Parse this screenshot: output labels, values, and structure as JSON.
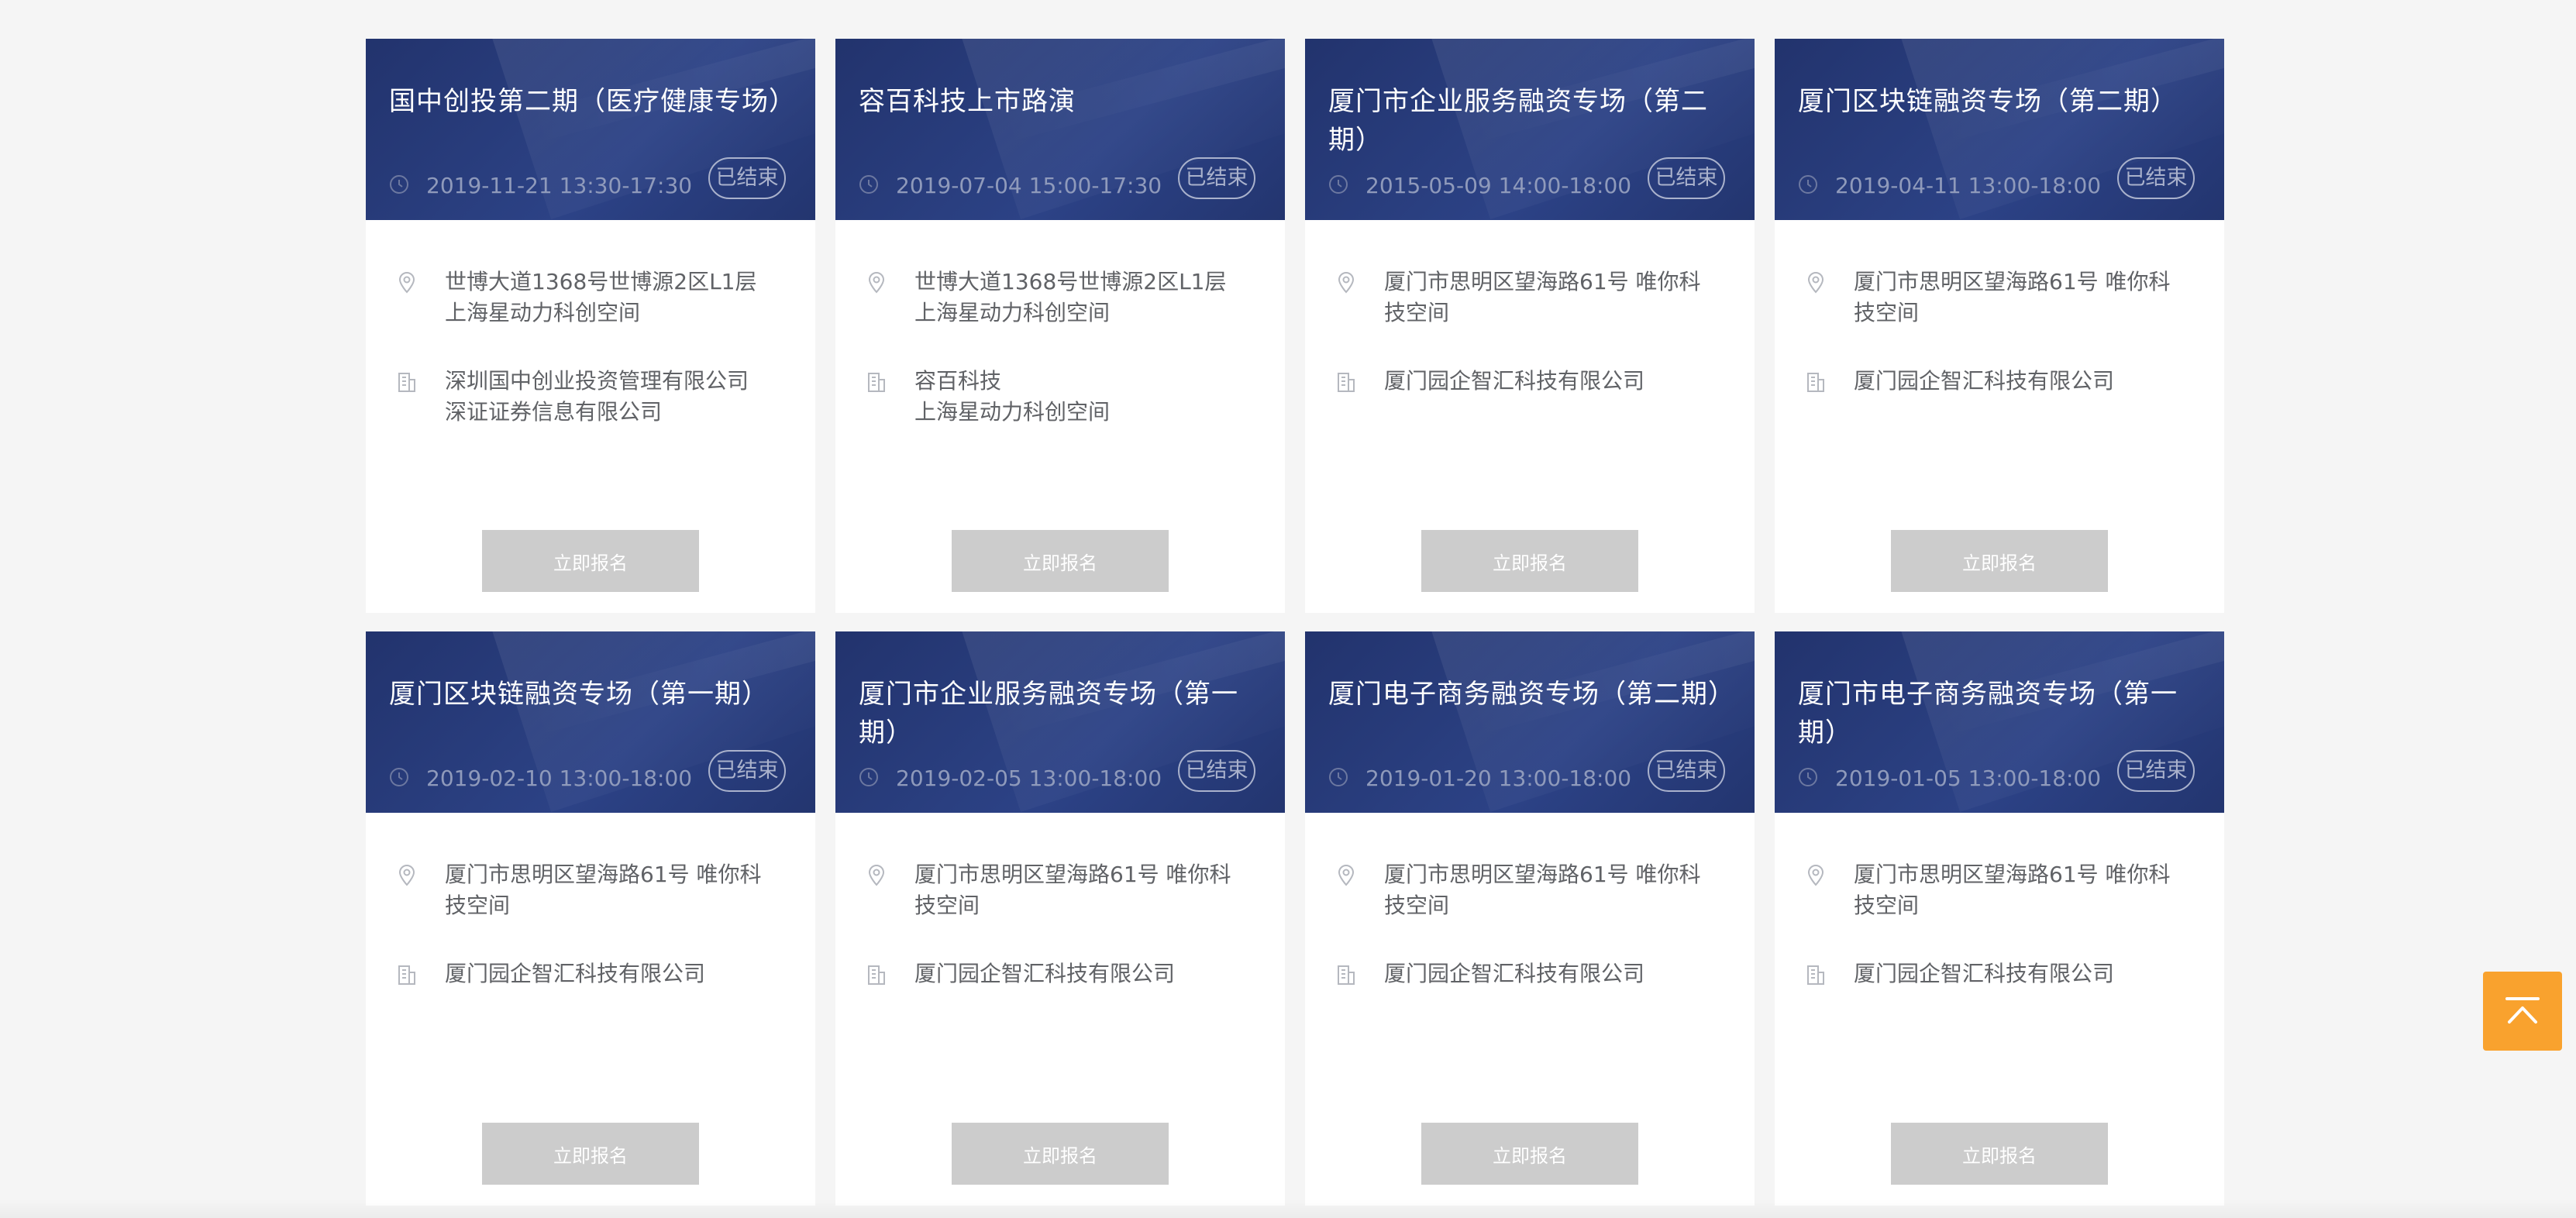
{
  "events": [
    {
      "title": "国中创投第二期（医疗健康专场）",
      "time": "2019-11-21 13:30-17:30",
      "status": "已结束",
      "address": "世博大道1368号世博源2区L1层上海星动力科创空间",
      "organizer": "深圳国中创业投资管理有限公司\n深证证券信息有限公司",
      "button": "立即报名"
    },
    {
      "title": "容百科技上市路演",
      "time": "2019-07-04 15:00-17:30",
      "status": "已结束",
      "address": "世博大道1368号世博源2区L1层上海星动力科创空间",
      "organizer": "容百科技\n上海星动力科创空间",
      "button": "立即报名"
    },
    {
      "title": "厦门市企业服务融资专场（第二期）",
      "time": "2015-05-09 14:00-18:00",
      "status": "已结束",
      "address": "厦门市思明区望海路61号 唯你科技空间",
      "organizer": "厦门园企智汇科技有限公司",
      "button": "立即报名"
    },
    {
      "title": "厦门区块链融资专场（第二期）",
      "time": "2019-04-11 13:00-18:00",
      "status": "已结束",
      "address": "厦门市思明区望海路61号 唯你科技空间",
      "organizer": "厦门园企智汇科技有限公司",
      "button": "立即报名"
    },
    {
      "title": "厦门区块链融资专场（第一期）",
      "time": "2019-02-10 13:00-18:00",
      "status": "已结束",
      "address": "厦门市思明区望海路61号 唯你科技空间",
      "organizer": "厦门园企智汇科技有限公司",
      "button": "立即报名"
    },
    {
      "title": "厦门市企业服务融资专场（第一期）",
      "time": "2019-02-05 13:00-18:00",
      "status": "已结束",
      "address": "厦门市思明区望海路61号 唯你科技空间",
      "organizer": "厦门园企智汇科技有限公司",
      "button": "立即报名"
    },
    {
      "title": "厦门电子商务融资专场（第二期）",
      "time": "2019-01-20 13:00-18:00",
      "status": "已结束",
      "address": "厦门市思明区望海路61号 唯你科技空间",
      "organizer": "厦门园企智汇科技有限公司",
      "button": "立即报名"
    },
    {
      "title": "厦门市电子商务融资专场（第一期）",
      "time": "2019-01-05 13:00-18:00",
      "status": "已结束",
      "address": "厦门市思明区望海路61号 唯你科技空间",
      "organizer": "厦门园企智汇科技有限公司",
      "button": "立即报名"
    }
  ],
  "icons": {
    "time": "clock-icon",
    "address": "location-pin-icon",
    "organizer": "building-icon",
    "back_to_top": "arrow-up-to-top-icon"
  },
  "colors": {
    "header_bg": "#22336d",
    "button_disabled": "#cccccc",
    "back_to_top": "#f9a22e"
  }
}
